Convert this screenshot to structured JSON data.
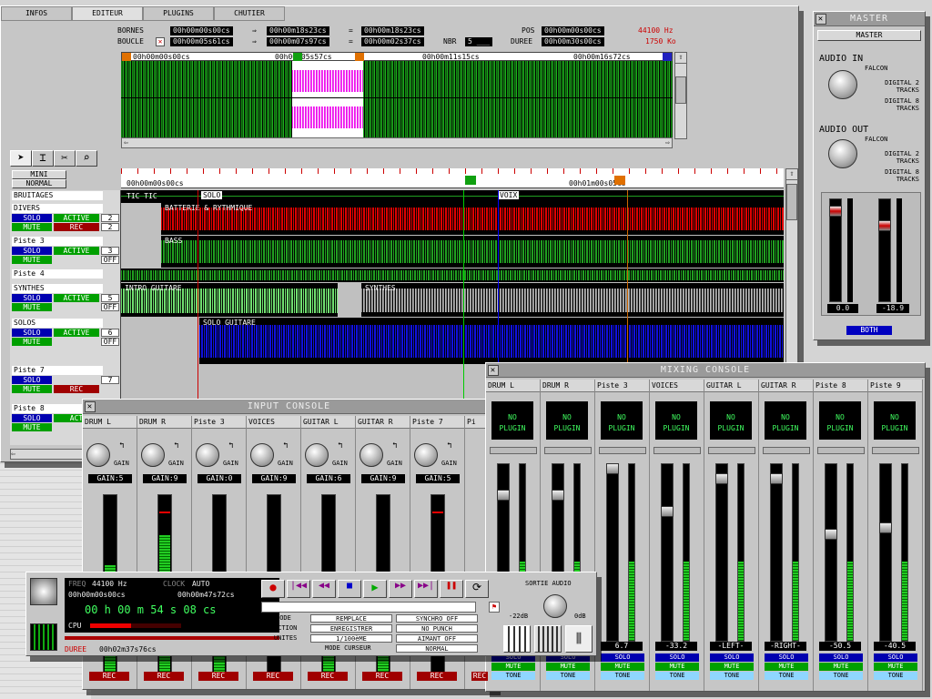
{
  "editor": {
    "tabs": [
      "INFOS",
      "EDITEUR",
      "PLUGINS",
      "CHUTIER"
    ],
    "active_tab": "EDITEUR",
    "bornes_label": "BORNES",
    "boucle_label": "BOUCLE",
    "bornes_start": "00h00m00s00cs",
    "bornes_end": "00h00m18s23cs",
    "bornes_len": "00h00m18s23cs",
    "boucle_start": "00h00m05s61cs",
    "boucle_end": "00h00m07s97cs",
    "boucle_len": "00h00m02s37cs",
    "nbr_label": "NBR",
    "nbr_value": "5 ___",
    "pos_label": "POS",
    "pos_value": "00h00m00s00cs",
    "duree_label": "DUREE",
    "duree_value": "00h00m30s00cs",
    "rate": "44100 Hz",
    "size": "1750 Ko",
    "overview_times": [
      "00h00m00s00cs",
      "00h00m05s57cs",
      "00h00m11s15cs",
      "00h00m16s72cs"
    ],
    "mini_label": "MINI",
    "normal_label": "NORMAL",
    "ruler_time": "00h01m00s05cs",
    "tracks": [
      {
        "name": "BRUITAGES",
        "regions": [
          "TIC TIC",
          "SOLO",
          "VOIX"
        ]
      },
      {
        "name": "DIVERS",
        "solo": "SOLO",
        "mute": "MUTE",
        "active": "ACTIVE",
        "rec": "REC",
        "num1": "2",
        "num2": "2",
        "region": "BATTERIE & RYTHMIQUE"
      },
      {
        "name": "Piste 3",
        "solo": "SOLO",
        "mute": "MUTE",
        "active": "ACTIVE",
        "num1": "3",
        "num2": "OFF",
        "region": "BASS"
      },
      {
        "name": "Piste 4"
      },
      {
        "name": "SYNTHES",
        "solo": "SOLO",
        "mute": "MUTE",
        "active": "ACTIVE",
        "num1": "5",
        "num2": "OFF",
        "region": "INTRO GUITARE",
        "region2": "SYNTHES"
      },
      {
        "name": "SOLOS",
        "solo": "SOLO",
        "mute": "MUTE",
        "active": "ACTIVE",
        "num1": "6",
        "num2": "OFF",
        "region": "SOLO GUITARE"
      },
      {
        "name": "Piste 7",
        "solo": "SOLO",
        "mute": "MUTE",
        "rec": "REC",
        "num1": "7"
      },
      {
        "name": "Piste 8",
        "solo": "SOLO",
        "mute": "MUTE",
        "active": "ACT"
      }
    ]
  },
  "master": {
    "title": "MASTER",
    "button": "MASTER",
    "audio_in": "AUDIO IN",
    "audio_out": "AUDIO OUT",
    "opt_falcon": "FALCON",
    "opt_digital2": "DIGITAL 2 TRACKS",
    "opt_digital8": "DIGITAL 8 TRACKS",
    "left_value": "0.0",
    "right_value": "-18.9",
    "both": "BOTH"
  },
  "input_console": {
    "title": "INPUT CONSOLE",
    "gain_label": "GAIN",
    "channels": [
      {
        "name": "DRUM L",
        "gain": "GAIN:5"
      },
      {
        "name": "DRUM R",
        "gain": "GAIN:9"
      },
      {
        "name": "Piste 3",
        "gain": "GAIN:0"
      },
      {
        "name": "VOICES",
        "gain": "GAIN:9"
      },
      {
        "name": "GUITAR L",
        "gain": "GAIN:6"
      },
      {
        "name": "GUITAR R",
        "gain": "GAIN:9"
      },
      {
        "name": "Piste 7",
        "gain": "GAIN:5"
      },
      {
        "name": "Pi"
      }
    ],
    "rec_label": "REC"
  },
  "mixing_console": {
    "title": "MIXING CONSOLE",
    "no_plugin": "NO PLUGIN",
    "channels": [
      {
        "name": "DRUM L",
        "value": ""
      },
      {
        "name": "DRUM R",
        "value": ""
      },
      {
        "name": "Piste 3",
        "value": "6.7"
      },
      {
        "name": "VOICES",
        "value": "-33.2"
      },
      {
        "name": "GUITAR L",
        "value": "-LEFT-"
      },
      {
        "name": "GUITAR R",
        "value": "-RIGHT-"
      },
      {
        "name": "Piste 8",
        "value": "-50.5"
      },
      {
        "name": "Piste 9",
        "value": "-40.5"
      }
    ],
    "solo": "SOLO",
    "mute": "MUTE",
    "tone": "TONE"
  },
  "transport": {
    "freq_label": "FREQ",
    "freq_value": "44100 Hz",
    "clock_label": "CLOCK",
    "clock_value": "AUTO",
    "pos1": "00h00m00s00cs",
    "pos2": "00h00m47s72cs",
    "main_time": "00 h 00 m 54 s 08 cs",
    "cpu_label": "CPU",
    "duree_label": "DUREE",
    "duree_value": "00h02m37s76cs",
    "mode_label": "MODE",
    "mode_value": "REMPLACE",
    "action_label": "ACTION",
    "action_value": "ENREGISTRER",
    "unites_label": "UNITES",
    "unites_value": "1/100èME",
    "curseur_label": "MODE CURSEUR",
    "curseur_value": "NORMAL",
    "synchro": "SYNCHRO OFF",
    "punch": "NO PUNCH",
    "aimant": "AIMANT OFF",
    "sortie": "SORTIE AUDIO",
    "db_min": "-22dB",
    "db_max": "0dB"
  },
  "colors": {
    "red": "#e00000",
    "green": "#20a020",
    "magenta": "#ff30ff",
    "blue": "#1010e0",
    "grey": "#888888",
    "lightgreen": "#70e070"
  }
}
